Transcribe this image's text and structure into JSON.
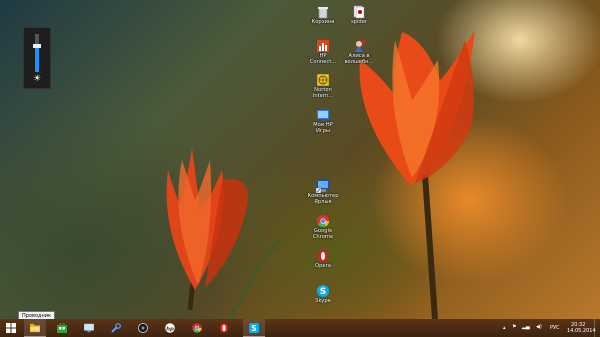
{
  "desktop": {
    "icons": [
      {
        "label": "Корзина",
        "icon": "recycle-bin-icon"
      },
      {
        "label": "spider",
        "icon": "spider-solitaire-icon"
      },
      {
        "label": "HP\nConnect...",
        "icon": "hp-connected-icon"
      },
      {
        "label": "Алиса в\nволшебн...",
        "icon": "alice-game-icon"
      },
      {
        "label": "Norton\nIntern...",
        "icon": "norton-internet-security-icon"
      },
      {
        "label": "Мои HP\nИгры",
        "icon": "hp-games-icon"
      },
      {
        "label": "Компьютер\nЯрлык",
        "icon": "computer-shortcut-icon"
      },
      {
        "label": "Google\nChrome",
        "icon": "chrome-icon"
      },
      {
        "label": "Opera",
        "icon": "opera-icon"
      },
      {
        "label": "Skype",
        "icon": "skype-icon"
      }
    ],
    "brightness_level": 0.68
  },
  "tooltip": "Проводник",
  "taskbar": {
    "items": [
      {
        "name": "start-button",
        "icon": "windows-logo-icon"
      },
      {
        "name": "explorer-button",
        "icon": "folder-icon",
        "active": true
      },
      {
        "name": "store-button",
        "icon": "store-icon"
      },
      {
        "name": "desktop-app-button",
        "icon": "monitor-icon"
      },
      {
        "name": "tool-button",
        "icon": "wrench-icon"
      },
      {
        "name": "camera-button",
        "icon": "webcam-icon"
      },
      {
        "name": "hp-button",
        "icon": "hp-logo-icon"
      },
      {
        "name": "chrome-taskbar-button",
        "icon": "chrome-icon"
      },
      {
        "name": "opera-taskbar-button",
        "icon": "opera-icon"
      },
      {
        "name": "skype-taskbar-button",
        "icon": "skype-icon",
        "active": true
      }
    ],
    "tray": {
      "language": "РУС",
      "time": "20:32",
      "date": "14.05.2014"
    }
  },
  "colors": {
    "taskbar": "#4a2c12",
    "accent": "#1e90ff"
  }
}
